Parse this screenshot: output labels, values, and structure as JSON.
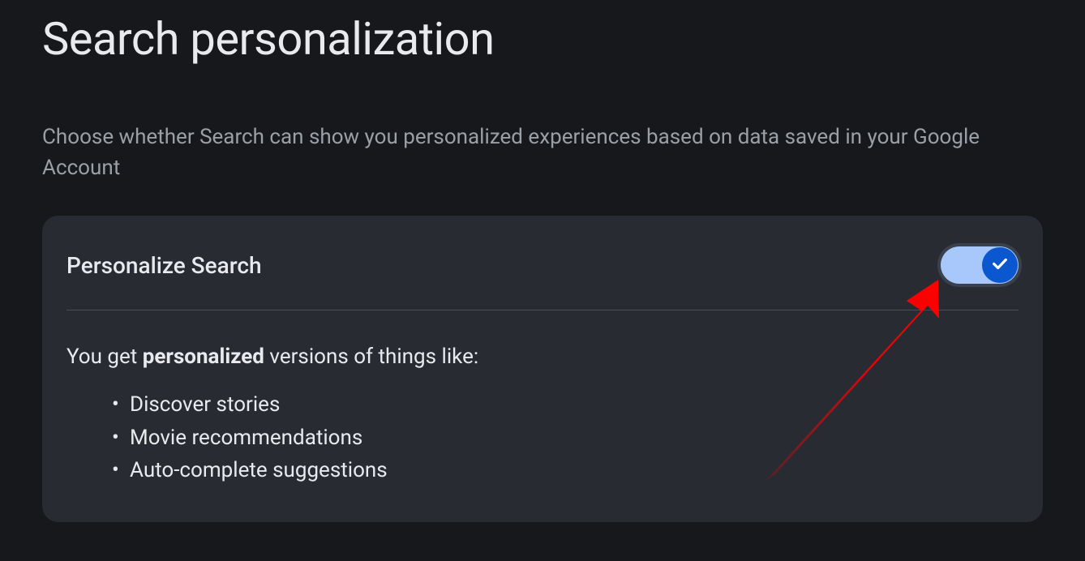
{
  "page": {
    "title": "Search personalization",
    "description": "Choose whether Search can show you personalized experiences based on data saved in your Google Account"
  },
  "card": {
    "title": "Personalize Search",
    "toggle_on": true,
    "body_prefix": "You get ",
    "body_bold": "personalized",
    "body_suffix": " versions of things like:",
    "features": [
      "Discover stories",
      "Movie recommendations",
      "Auto-complete suggestions"
    ]
  }
}
